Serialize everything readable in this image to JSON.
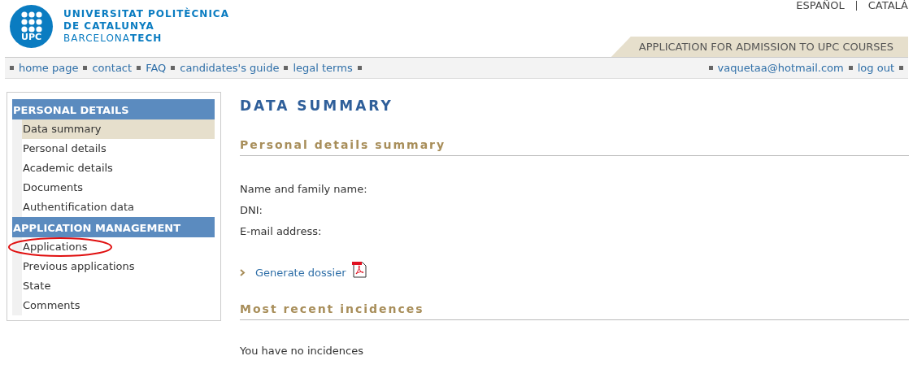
{
  "logo": {
    "badge": "UPC",
    "lines": [
      "UNIVERSITAT POLITÈCNICA",
      "DE CATALUNYA",
      "BARCELONA**TECH**"
    ]
  },
  "languages": [
    "ESPAÑOL",
    "CATALÀ"
  ],
  "banner": "APPLICATION FOR ADMISSION TO UPC COURSES",
  "nav_links": [
    "home page",
    "contact",
    "FAQ",
    "candidates's guide",
    "legal terms"
  ],
  "user_links": [
    "vaquetaa@hotmail.com",
    "log out"
  ],
  "sidebar": {
    "sections": [
      {
        "title": "PERSONAL DETAILS",
        "items": [
          {
            "label": "Data summary",
            "selected": true,
            "circled": false
          },
          {
            "label": "Personal details",
            "selected": false,
            "circled": false
          },
          {
            "label": "Academic details",
            "selected": false,
            "circled": false
          },
          {
            "label": "Documents",
            "selected": false,
            "circled": false
          },
          {
            "label": "Authentification data",
            "selected": false,
            "circled": false
          }
        ]
      },
      {
        "title": "APPLICATION MANAGEMENT",
        "items": [
          {
            "label": "Applications",
            "selected": false,
            "circled": true
          },
          {
            "label": "Previous applications",
            "selected": false,
            "circled": false
          },
          {
            "label": "State",
            "selected": false,
            "circled": false
          },
          {
            "label": "Comments",
            "selected": false,
            "circled": false
          }
        ]
      }
    ]
  },
  "page_title": "DATA SUMMARY",
  "sections": [
    {
      "heading": "Personal details summary",
      "fields": [
        "Name and family name:",
        "DNI:",
        "E-mail address:"
      ],
      "link": "Generate dossier"
    },
    {
      "heading": "Most recent incidences",
      "message": "You have no incidences"
    }
  ]
}
